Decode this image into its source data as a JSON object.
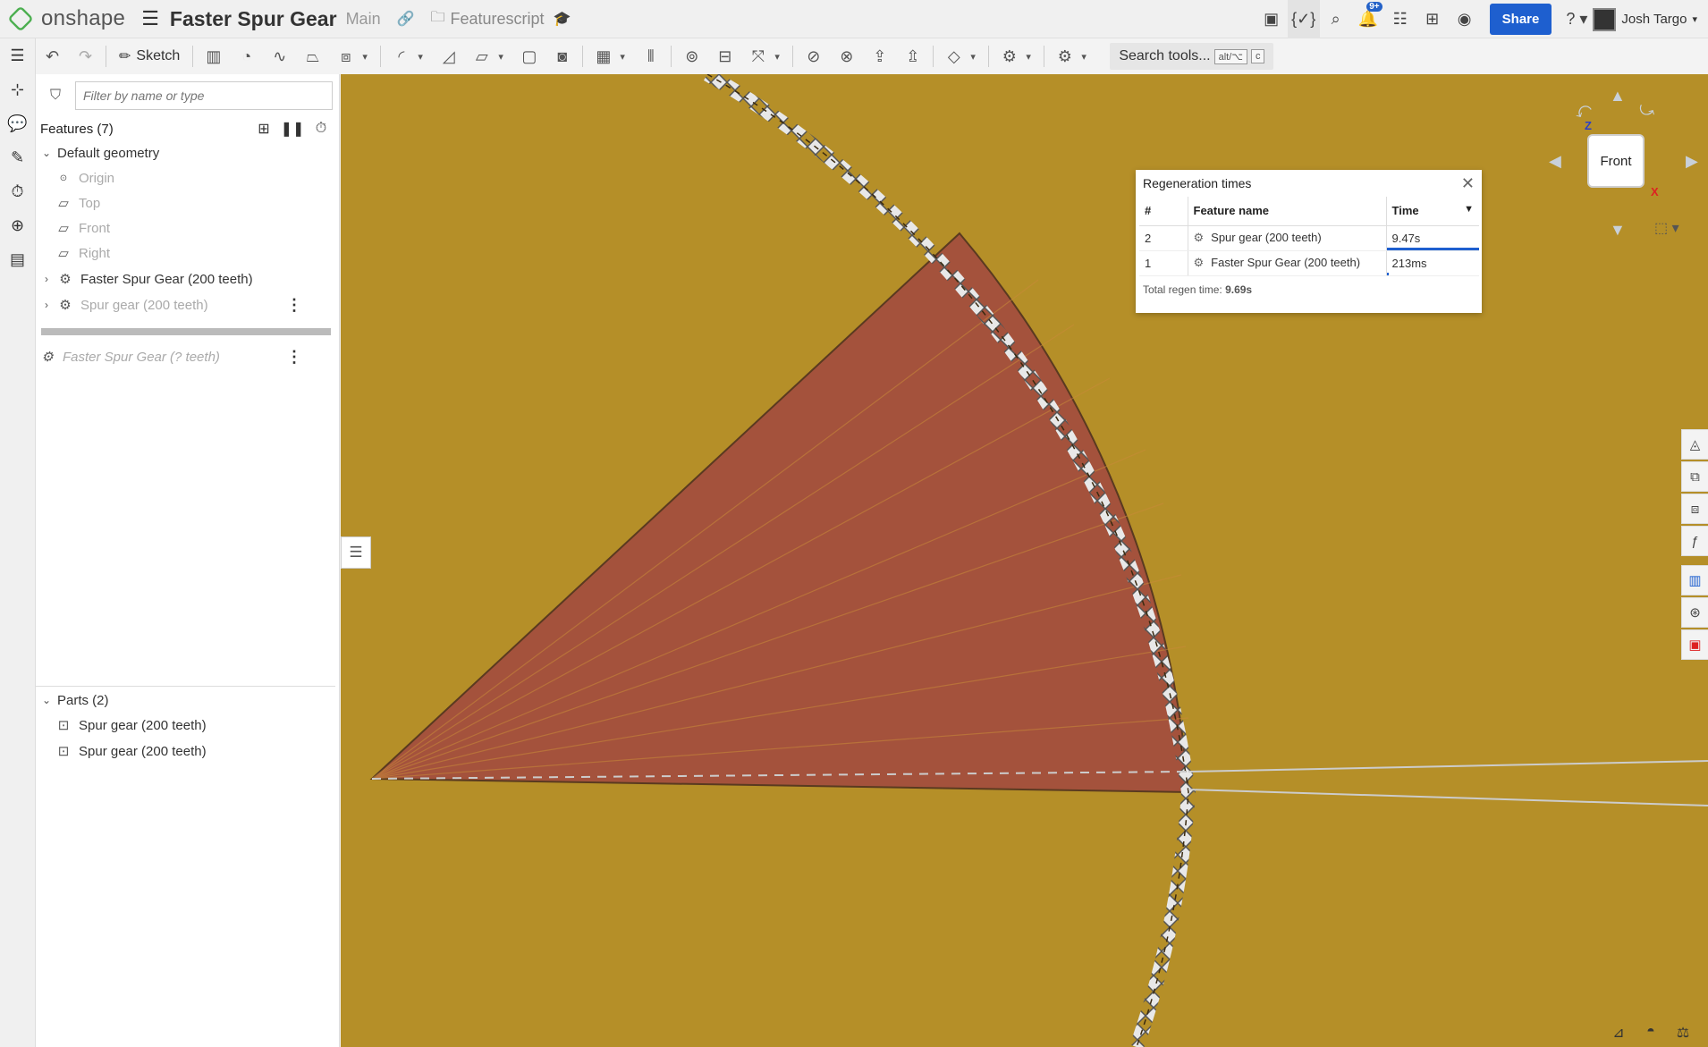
{
  "app": {
    "brand": "onshape",
    "doc_title": "Faster Spur Gear",
    "branch": "Main",
    "folder": "Featurescript"
  },
  "topbar": {
    "notification_count": "9+",
    "share_label": "Share",
    "help_label": "?",
    "user_name": "Josh Targo"
  },
  "toolbar": {
    "sketch_label": "Sketch",
    "search_label": "Search tools...",
    "search_shortcut_1": "alt/⌥",
    "search_shortcut_2": "c"
  },
  "feature_panel": {
    "filter_placeholder": "Filter by name or type",
    "features_title": "Features (7)",
    "default_geometry": "Default geometry",
    "origin": "Origin",
    "plane_top": "Top",
    "plane_front": "Front",
    "plane_right": "Right",
    "feature_1": "Faster Spur Gear (200 teeth)",
    "feature_2": "Spur gear (200 teeth)",
    "rolled_feature": "Faster Spur Gear (? teeth)",
    "parts_title": "Parts (2)",
    "part_1": "Spur gear (200 teeth)",
    "part_2": "Spur gear (200 teeth)"
  },
  "regen_dialog": {
    "title": "Regeneration times",
    "col_num": "#",
    "col_name": "Feature name",
    "col_time": "Time",
    "rows": [
      {
        "num": "2",
        "name": "Spur gear (200 teeth)",
        "time": "9.47s",
        "fraction": 1.0
      },
      {
        "num": "1",
        "name": "Faster Spur Gear (200 teeth)",
        "time": "213ms",
        "fraction": 0.02
      }
    ],
    "total_label": "Total regen time:",
    "total_value": "9.69s"
  },
  "viewcube": {
    "face": "Front",
    "axis_z": "Z",
    "axis_x": "X"
  },
  "colors": {
    "viewport_bg": "#b58f28",
    "section_fill": "#a4523c",
    "accent": "#1e5fcf"
  }
}
